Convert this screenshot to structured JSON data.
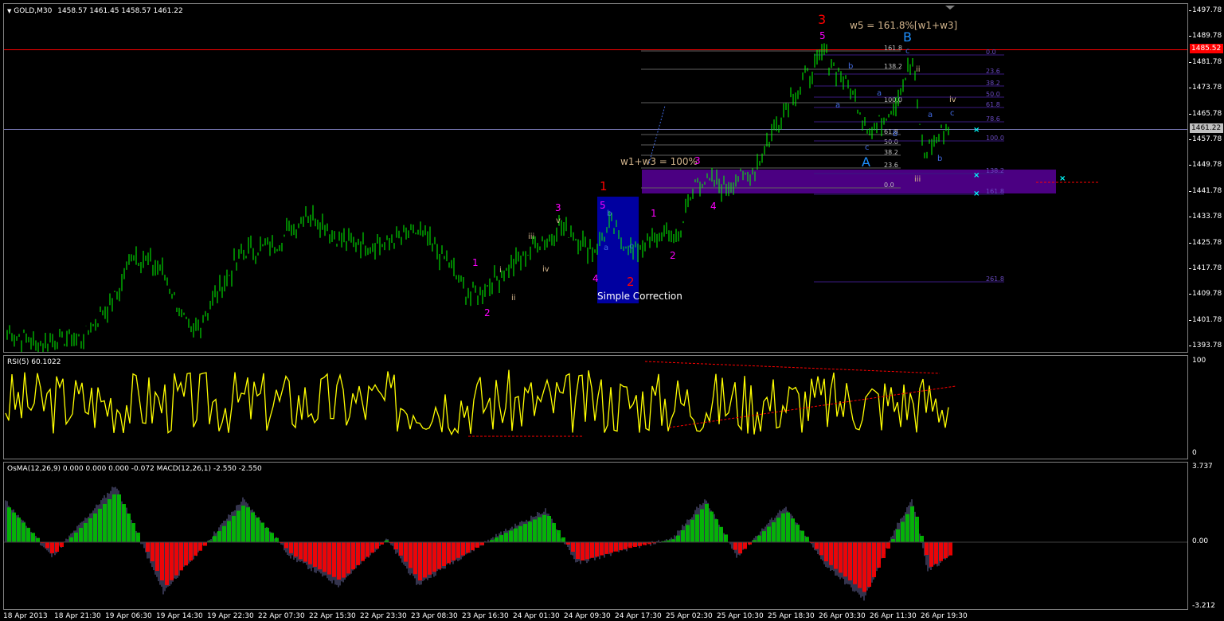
{
  "chart_header": {
    "symbol": "GOLD,M30",
    "ohlc": "1458.57 1461.45 1458.57 1461.22"
  },
  "colors": {
    "background": "#000000",
    "candles": "#00ff00",
    "rsi_line": "#ffff00",
    "macd_pos": "#00c000",
    "macd_neg": "#ff0000",
    "zone": "#4b0082",
    "simple_correction_box": "#0000a0",
    "resistance_line": "#ff0000"
  },
  "price_axis": [
    "1497.78",
    "1489.78",
    "1481.78",
    "1473.78",
    "1465.78",
    "1457.78",
    "1449.78",
    "1441.78",
    "1433.78",
    "1425.78",
    "1417.78",
    "1409.78",
    "1401.78",
    "1393.78"
  ],
  "price_tags": {
    "resistance": "1485.52",
    "current": "1461.22"
  },
  "rsi": {
    "label": "RSI(5) 60.1022",
    "axis_top": "100",
    "axis_bottom": "0"
  },
  "macd": {
    "label": "OsMA(12,26,9) 0.000 0.000 0.000 -0.072  MACD(12,26,1) -2.550 -2.550",
    "axis_top": "3.737",
    "axis_mid": "0.00",
    "axis_bottom": "-3.212"
  },
  "time_axis": [
    "18 Apr 2013",
    "18 Apr 21:30",
    "19 Apr 06:30",
    "19 Apr 14:30",
    "19 Apr 22:30",
    "22 Apr 07:30",
    "22 Apr 15:30",
    "22 Apr 23:30",
    "23 Apr 08:30",
    "23 Apr 16:30",
    "24 Apr 01:30",
    "24 Apr 09:30",
    "24 Apr 17:30",
    "25 Apr 02:30",
    "25 Apr 10:30",
    "25 Apr 18:30",
    "26 Apr 03:30",
    "26 Apr 11:30",
    "26 Apr 19:30"
  ],
  "annotations": {
    "w5_label": "w5 = 161.8%[w1+w3]",
    "w1w3_label": "w1+w3 = 100%",
    "simple_correction": "Simple Correction",
    "wave_1_red": "1",
    "wave_2_red": "2",
    "wave_3_red": "3",
    "wave_A": "A",
    "wave_B": "B",
    "m1a": "1",
    "m2a": "2",
    "m3a": "3",
    "m4a": "4",
    "m5a": "5",
    "m1b": "1",
    "m2b": "2",
    "m3b": "3",
    "m4b": "4",
    "m5b": "5",
    "i": "i",
    "ii": "ii",
    "iii": "iii",
    "iv": "iv",
    "v": "v",
    "ii2": "ii",
    "iii2": "iii",
    "iv2": "iv",
    "a1": "a",
    "b1": "b",
    "c1": "c",
    "a2": "a",
    "b2": "b",
    "c2": "c",
    "a3": "a",
    "b3": "b",
    "c3": "c",
    "a4": "a",
    "b4": "b",
    "c4": "c"
  },
  "fib_levels": [
    "161.8",
    "138.2",
    "100.0",
    "61.8",
    "50.0",
    "38.2",
    "23.6",
    "0.0"
  ],
  "fib_levels_right": [
    "0.0",
    "23.6",
    "38.2",
    "50.0",
    "61.8",
    "78.6",
    "100.0",
    "138.2",
    "161.8",
    "261.8"
  ]
}
